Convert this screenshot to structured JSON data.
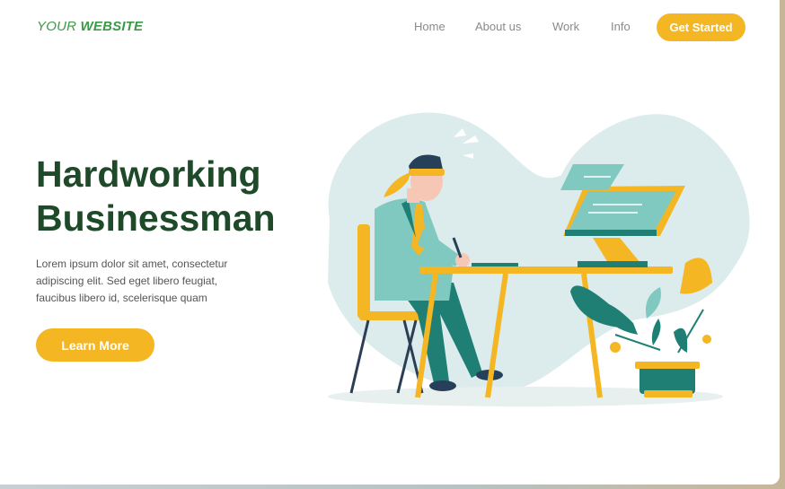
{
  "header": {
    "logo_prefix": "YOUR",
    "logo_bold": "WEBSITE",
    "nav": [
      "Home",
      "About us",
      "Work",
      "Info"
    ],
    "cta_label": "Get Started"
  },
  "hero": {
    "title_line1": "Hardworking",
    "title_line2": "Businessman",
    "description": "Lorem ipsum dolor sit amet, consectetur adipiscing elit. Sed eget libero feugiat, faucibus libero id, scelerisque quam",
    "button_label": "Learn More"
  },
  "colors": {
    "brand_green": "#3b9a46",
    "title_green": "#1f4a2a",
    "accent_yellow": "#f5b623",
    "teal": "#1f7f74",
    "blob": "#dcecec"
  },
  "illustration": {
    "subject": "businessman-at-desk-illustration"
  }
}
